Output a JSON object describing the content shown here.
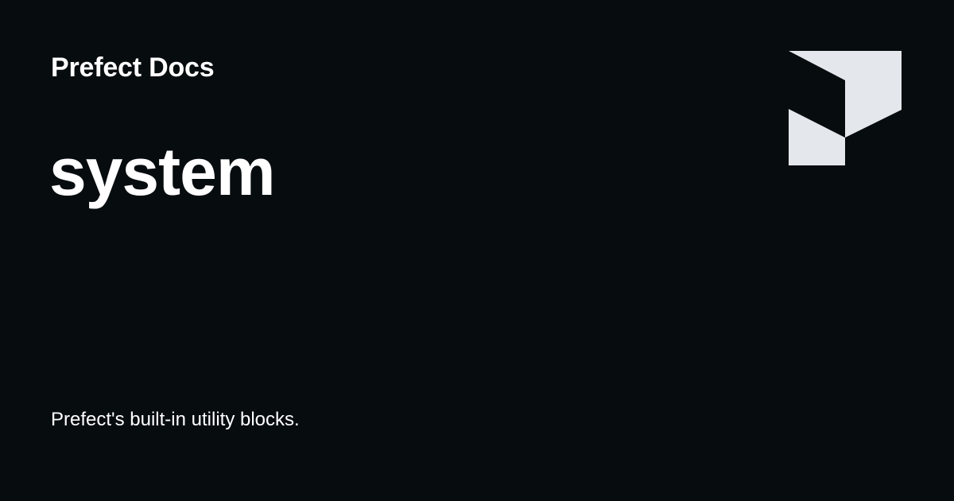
{
  "site": {
    "name": "Prefect Docs"
  },
  "page": {
    "title": "system",
    "description": "Prefect's built-in utility blocks."
  },
  "logo": {
    "icon": "prefect-logo-icon",
    "color": "#e4e7ec"
  },
  "theme": {
    "background": "#070c0f",
    "text": "#ffffff"
  }
}
